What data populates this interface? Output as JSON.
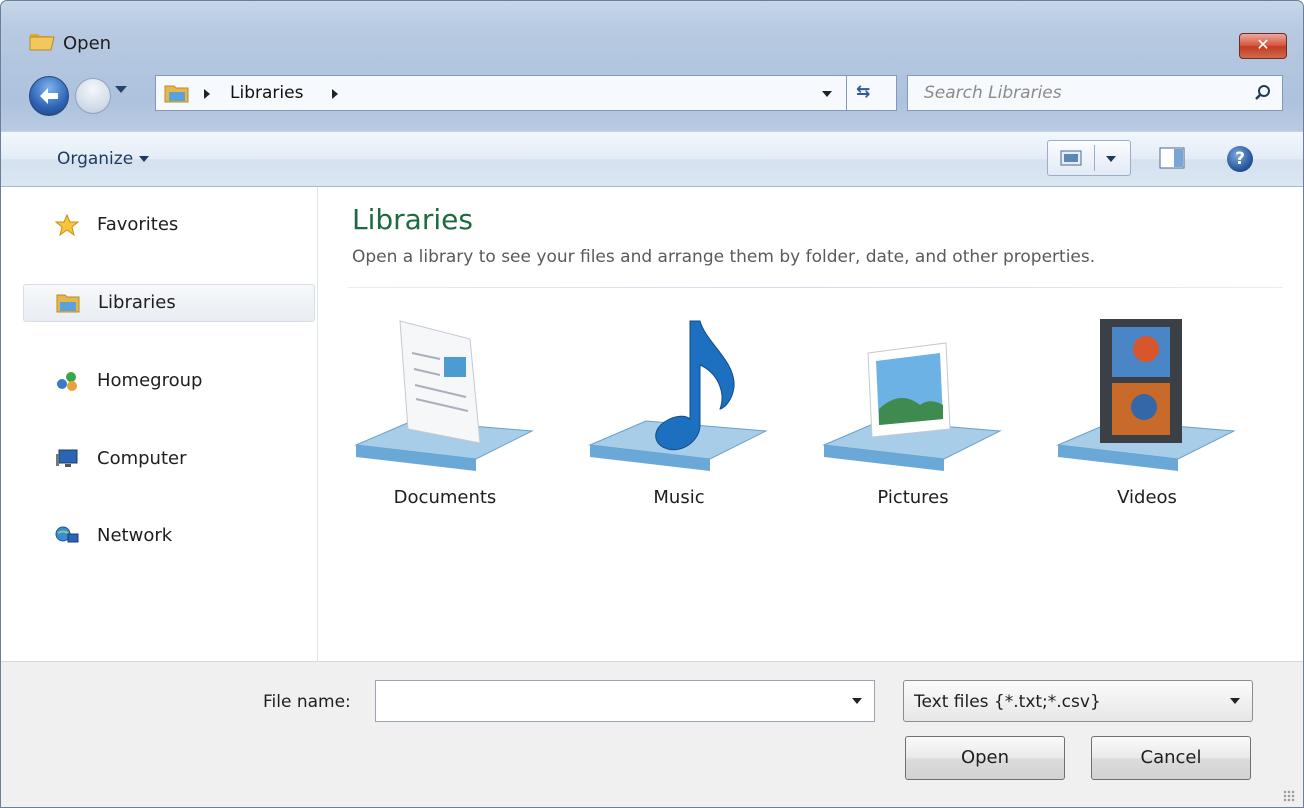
{
  "window": {
    "title": "Open",
    "close_label": "✕"
  },
  "address_bar": {
    "path": "Libraries"
  },
  "search": {
    "placeholder": "Search Libraries"
  },
  "toolbar": {
    "organize_label": "Organize"
  },
  "sidebar": {
    "items": [
      {
        "label": "Favorites",
        "icon": "star-icon"
      },
      {
        "label": "Libraries",
        "icon": "libraries-icon",
        "selected": true
      },
      {
        "label": "Homegroup",
        "icon": "homegroup-icon"
      },
      {
        "label": "Computer",
        "icon": "computer-icon"
      },
      {
        "label": "Network",
        "icon": "network-icon"
      }
    ]
  },
  "content": {
    "title": "Libraries",
    "subtitle": "Open a library to see your files and arrange them by folder, date, and other properties.",
    "libraries": [
      {
        "label": "Documents",
        "icon": "documents-library-icon"
      },
      {
        "label": "Music",
        "icon": "music-library-icon"
      },
      {
        "label": "Pictures",
        "icon": "pictures-library-icon"
      },
      {
        "label": "Videos",
        "icon": "videos-library-icon"
      }
    ]
  },
  "footer": {
    "file_name_label": "File name:",
    "file_name_value": "",
    "file_type": "Text files {*.txt;*.csv}",
    "open_label": "Open",
    "cancel_label": "Cancel"
  },
  "colors": {
    "accent_title": "#1d6b3f",
    "close_button": "#c43b23",
    "frame": "#b7cae1"
  }
}
